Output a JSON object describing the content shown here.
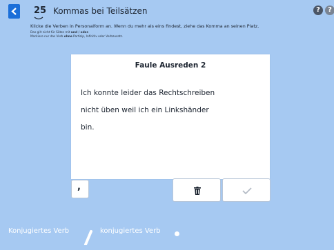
{
  "header": {
    "lesson_number": "25",
    "title": "Kommas bei Teilsätzen",
    "help_icons": [
      "help-icon",
      "help-icon"
    ],
    "help_glyph": "?"
  },
  "instructions": {
    "main": "Klicke die Verben in Personalform an. Wenn du mehr als eins findest, ziehe das Komma an seinen Platz.",
    "note1_prefix": "Das gilt nicht für Sätze mit ",
    "note1_bold": "und / oder",
    "note1_suffix": ".",
    "note2_prefix": "Markiere nur das Verb ",
    "note2_bold": "ohne",
    "note2_suffix": " Partizip, Infinitiv oder Verbzusatz."
  },
  "card": {
    "title": "Faule Ausreden 2",
    "lines": [
      "Ich konnte leider das Rechtschreiben",
      "nicht üben weil ich ein Linkshänder",
      "bin."
    ]
  },
  "controls": {
    "comma_label": ",",
    "trash_icon": "trash-icon",
    "check_icon": "check-icon"
  },
  "pattern": {
    "verb1": "Konjugiertes Verb",
    "verb2": "konjugiertes Verb"
  },
  "colors": {
    "background": "#a6c9f2",
    "accent": "#1b6fd9"
  }
}
